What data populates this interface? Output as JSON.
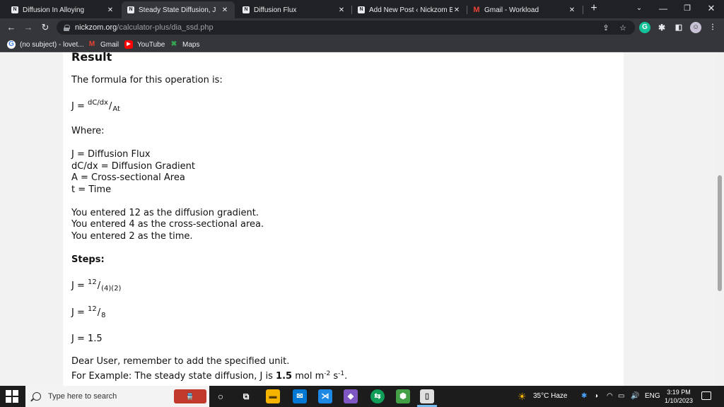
{
  "tabs": [
    {
      "title": "Diffusion In Alloying",
      "favicon": "nickzom-icon"
    },
    {
      "title": "Steady State Diffusion, J",
      "favicon": "nickzom-icon",
      "active": true
    },
    {
      "title": "Diffusion Flux",
      "favicon": "nickzom-icon"
    },
    {
      "title": "Add New Post ‹ Nickzom Blo",
      "favicon": "nickzom-icon"
    },
    {
      "title": "Gmail - Workload",
      "favicon": "gmail-icon"
    }
  ],
  "address": {
    "host": "nickzom.org",
    "path": "/calculator-plus/dia_ssd.php"
  },
  "bookmarks": [
    {
      "label": "(no subject) - lovet...",
      "icon": "google-icon"
    },
    {
      "label": "Gmail",
      "icon": "gmail-icon"
    },
    {
      "label": "YouTube",
      "icon": "youtube-icon"
    },
    {
      "label": "Maps",
      "icon": "maps-icon"
    }
  ],
  "page": {
    "heading": "Result",
    "formula_intro": "The formula for this operation is:",
    "formula": {
      "lhs": "J =",
      "num": "dC/dx",
      "den": "At"
    },
    "where_label": "Where:",
    "definitions": [
      "J = Diffusion Flux",
      "dC/dx = Diffusion Gradient",
      "A = Cross-sectional Area",
      "t = Time"
    ],
    "inputs": [
      "You entered 12 as the diffusion gradient.",
      "You entered 4 as the cross-sectional area.",
      "You entered 2 as the time."
    ],
    "steps_label": "Steps:",
    "step1": {
      "lhs": "J =",
      "num": "12",
      "den": "(4)(2)"
    },
    "step2": {
      "lhs": "J =",
      "num": "12",
      "den": "8"
    },
    "step3": "J = 1.5",
    "reminder": "Dear User, remember to add the specified unit.",
    "example": {
      "prefix": "For Example: The steady state diffusion, J is",
      "value": "1.5",
      "unit_m": "mol m",
      "exp_m": "-2",
      "unit_s": "s",
      "exp_s": "-1",
      "suffix": "."
    }
  },
  "taskbar": {
    "search_placeholder": "Type here to search",
    "weather": "35°C  Haze",
    "language": "ENG",
    "time": "3:19 PM",
    "date": "1/10/2023"
  },
  "colors": {
    "chrome_dark": "#202124",
    "chrome_toolbar": "#35363a",
    "page_bg": "#ffffff",
    "taskbar": "#1c1c1c"
  }
}
